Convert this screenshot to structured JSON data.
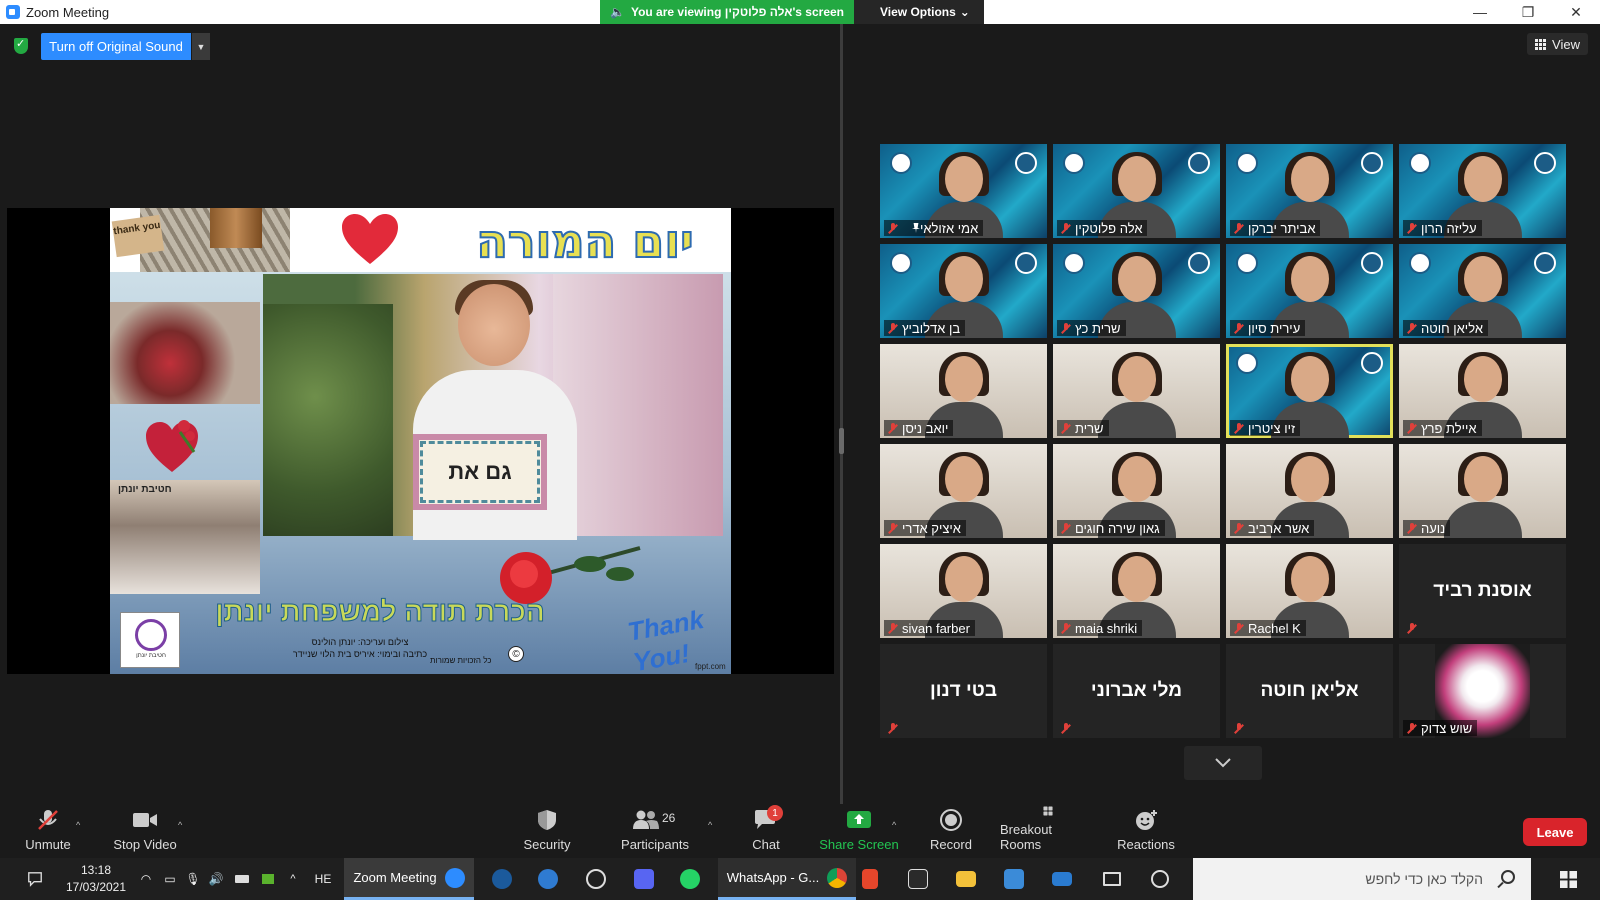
{
  "window": {
    "title": "Zoom Meeting",
    "controls": {
      "minimize": "—",
      "restore": "❐",
      "close": "✕"
    }
  },
  "share_banner": {
    "viewing_text": "You are viewing אלה פלוטקין's screen",
    "view_options_label": "View Options"
  },
  "top_controls": {
    "original_sound_label": "Turn off Original Sound",
    "view_label": "View"
  },
  "slide": {
    "thank_card": "thank you",
    "title": "יום המורה",
    "sign_text": "גם את",
    "collage_caption": "חטיבת יונתן",
    "thanks_banner": "הכרת תודה למשפחת יונתן",
    "credits_line1": "צילום ועריכה: יונתן הולינס",
    "credits_line2": "כתיבה ובימוי: איריס בית הלוי שניידר",
    "rights": "כל הזכויות שמורות",
    "copyright_symbol": "©",
    "logo_caption": "חטיבת יונתן",
    "thank_you_script": "Thank You!",
    "watermark": "fppt.com"
  },
  "gallery": {
    "participants": [
      {
        "name": "אמי אזולאי",
        "style": "cam",
        "pinned": true
      },
      {
        "name": "אלה פלוטקין",
        "style": "cam"
      },
      {
        "name": "אביתר יברקן",
        "style": "cam"
      },
      {
        "name": "עליזה הרון",
        "style": "cam"
      },
      {
        "name": "בן אדלוביץ",
        "style": "cam"
      },
      {
        "name": "שרית כץ",
        "style": "cam"
      },
      {
        "name": "עירית סיון",
        "style": "cam"
      },
      {
        "name": "אליאן חוטה",
        "style": "cam"
      },
      {
        "name": "יואב ניסן",
        "style": "room"
      },
      {
        "name": "שרית",
        "style": "room"
      },
      {
        "name": "זיו ציטרין",
        "style": "cam",
        "active": true
      },
      {
        "name": "איילת פרץ",
        "style": "room"
      },
      {
        "name": "איציק אדרי",
        "style": "room"
      },
      {
        "name": "גאון שירה חוגים",
        "style": "room"
      },
      {
        "name": "אשר ארביב",
        "style": "room"
      },
      {
        "name": "נועה",
        "style": "room"
      },
      {
        "name": "sivan farber",
        "style": "room"
      },
      {
        "name": "maia shriki",
        "style": "room"
      },
      {
        "name": "Rachel K",
        "style": "room"
      },
      {
        "name": "אוסנת רביד",
        "style": "dark",
        "center": true
      },
      {
        "name": "בטי דנון",
        "style": "dark",
        "center": true
      },
      {
        "name": "מלי אברוני",
        "style": "dark",
        "center": true
      },
      {
        "name": "אליאן חוטה",
        "style": "dark",
        "center": true
      },
      {
        "name": "שוש צדוק",
        "style": "flower"
      }
    ]
  },
  "toolbar": {
    "unmute": "Unmute",
    "stop_video": "Stop Video",
    "security": "Security",
    "participants": "Participants",
    "participants_count": "26",
    "chat": "Chat",
    "chat_badge": "1",
    "share_screen": "Share Screen",
    "record": "Record",
    "breakout_rooms": "Breakout Rooms",
    "reactions": "Reactions",
    "leave": "Leave"
  },
  "taskbar": {
    "time": "13:18",
    "date": "17/03/2021",
    "language": "HE",
    "zoom_item": "Zoom Meeting",
    "whatsapp_item": "WhatsApp - G...",
    "search_placeholder": "הקלד כאן כדי לחפש"
  },
  "colors": {
    "zoom_blue": "#2d8cff",
    "share_green": "#23a942",
    "leave_red": "#d9242b",
    "active_speaker": "#e3e05a"
  }
}
